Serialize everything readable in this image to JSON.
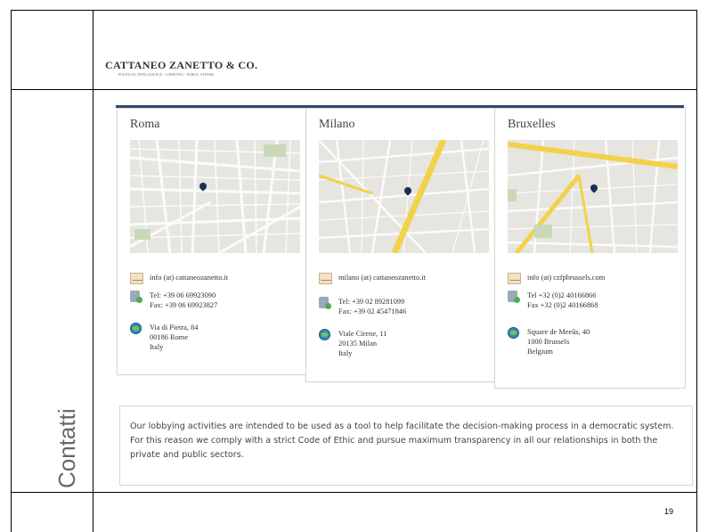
{
  "brand": {
    "name": "CATTANEO ZANETTO & CO.",
    "tagline": "POLITICAL INTELLIGENCE - LOBBYING - PUBLIC AFFAIRS"
  },
  "section_label": "Contatti",
  "offices": [
    {
      "city": "Roma",
      "email": "info (at) cattaneozanetto.it",
      "tel": "Tel: +39 06 69923090",
      "fax": "Fax: +39 06 69923827",
      "address": [
        "Via di Pietra, 84",
        "00186 Rome",
        "Italy"
      ]
    },
    {
      "city": "Milano",
      "email": "milano (at) cattaneozanetto.it",
      "tel": "Tel: +39 02 89281099",
      "fax": "Fax: +39 02 45471846",
      "address": [
        "Viale Cirene, 11",
        "20135 Milan",
        "Italy"
      ]
    },
    {
      "city": "Bruxelles",
      "email": "info (at) czfpbrussels.com",
      "tel": "Tel +32 (0)2 40166866",
      "fax": "Fax +32 (0)2 40166868",
      "address": [
        "Square de Meeûs, 40",
        "1000 Brussels",
        "Belgium"
      ]
    }
  ],
  "statement": "Our lobbying activities are intended to be used as a tool to help facilitate the decision-making process in a democratic system. For this reason we comply with a strict Code of Ethic and pursue maximum transparency in all our relationships in both the private and public sectors.",
  "page_number": "19",
  "colors": {
    "accent_line": "#2e4a6b",
    "map_pin": "#1c2f55",
    "map_road_major": "#f2d24b"
  }
}
